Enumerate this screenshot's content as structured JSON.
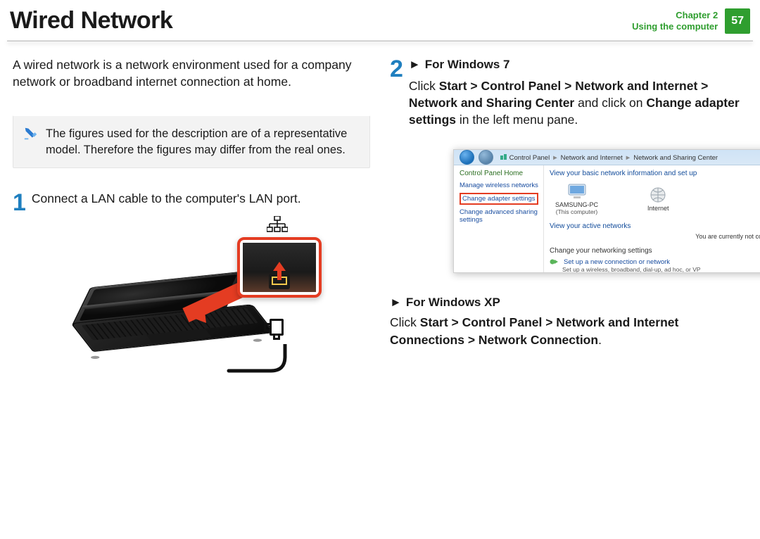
{
  "header": {
    "title": "Wired Network",
    "chapter_line": "Chapter 2",
    "subtitle": "Using the computer",
    "page_number": "57"
  },
  "intro": "A wired network is a network environment used for a company network or broadband internet connection at home.",
  "note": "The figures used for the description are of a representative model. Therefore the figures may differ from the real ones.",
  "step1": {
    "num": "1",
    "text": "Connect a LAN cable to the computer's LAN port."
  },
  "step2": {
    "num": "2",
    "win7_heading_prefix": "►",
    "win7_heading": "For Windows 7",
    "win7_line1_click": "Click ",
    "win7_line1_bold": "Start > Control Panel > Network and Internet > Network and Sharing Center",
    "win7_line1_mid": " and click on ",
    "win7_line1_bold2": "Change adapter settings",
    "win7_line1_end": " in the left menu pane."
  },
  "winshot": {
    "crumb1": "Control Panel",
    "crumb2": "Network and Internet",
    "crumb3": "Network and Sharing Center",
    "side_heading": "Control Panel Home",
    "side_link1": "Manage wireless networks",
    "side_link2": "Change adapter settings",
    "side_link3": "Change advanced sharing settings",
    "main_heading": "View your basic network information and set up",
    "pc_label": "SAMSUNG-PC",
    "pc_sub": "(This computer)",
    "internet_label": "Internet",
    "active_heading": "View your active networks",
    "not_connected": "You are currently not connected",
    "change_heading": "Change your networking settings",
    "setup_link": "Set up a new connection or network",
    "setup_sub": "Set up a wireless, broadband, dial-up, ad hoc, or VP"
  },
  "xp": {
    "heading_prefix": "►",
    "heading": "For Windows XP",
    "line_click": "Click ",
    "line_bold": "Start > Control Panel > Network and Internet Connections > Network Connection",
    "line_end": "."
  }
}
